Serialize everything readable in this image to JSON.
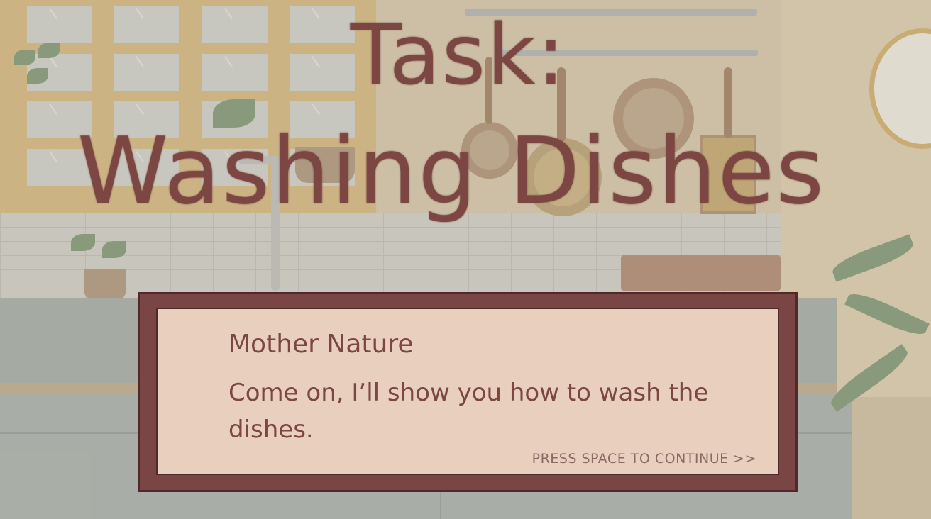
{
  "title": {
    "line1": "Task:",
    "line2": "Washing Dishes"
  },
  "dialog": {
    "speaker": "Mother Nature",
    "text": "Come on, I’ll show you how to wash the dishes.",
    "continue_prompt": "PRESS SPACE TO CONTINUE >>"
  },
  "colors": {
    "title_text": "#7c4743",
    "dialog_frame": "#7a4645",
    "dialog_fill": "#e9cfbd"
  },
  "icons": [
    "clock-icon",
    "frying-pan-icon",
    "potted-plant-icon",
    "faucet-icon",
    "dish-rack-icon"
  ]
}
